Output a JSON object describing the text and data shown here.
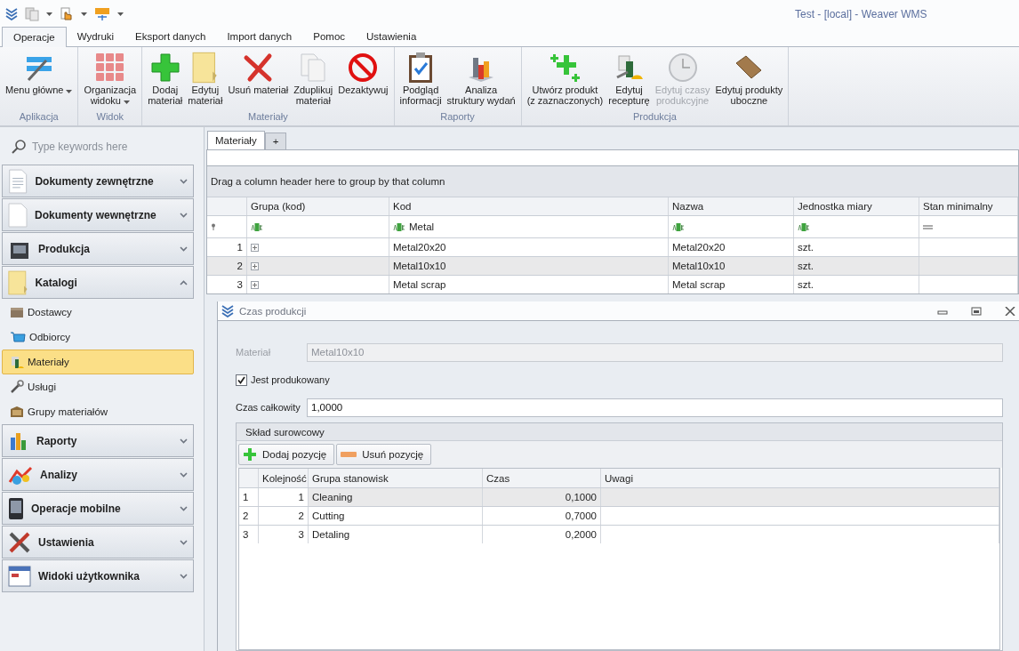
{
  "window": {
    "title": "Test - [local] - Weaver WMS"
  },
  "ribbon_tabs": [
    {
      "label": "Operacje",
      "selected": true
    },
    {
      "label": "Wydruki",
      "selected": false
    },
    {
      "label": "Eksport danych",
      "selected": false
    },
    {
      "label": "Import danych",
      "selected": false
    },
    {
      "label": "Pomoc",
      "selected": false
    },
    {
      "label": "Ustawienia",
      "selected": false
    }
  ],
  "ribbon_groups": [
    {
      "title": "Aplikacja",
      "buttons": [
        {
          "label": "Menu główne",
          "dropdown": true,
          "disabled": false
        }
      ]
    },
    {
      "title": "Widok",
      "buttons": [
        {
          "label": "Organizacja\nwidoku",
          "dropdown": true,
          "disabled": false
        }
      ]
    },
    {
      "title": "Materiały",
      "buttons": [
        {
          "label": "Dodaj\nmateriał",
          "dropdown": false,
          "disabled": false
        },
        {
          "label": "Edytuj\nmateriał",
          "dropdown": false,
          "disabled": false
        },
        {
          "label": "Usuń materiał",
          "dropdown": false,
          "disabled": false
        },
        {
          "label": "Zduplikuj\nmateriał",
          "dropdown": false,
          "disabled": false
        },
        {
          "label": "Dezaktywuj",
          "dropdown": false,
          "disabled": false
        }
      ]
    },
    {
      "title": "Raporty",
      "buttons": [
        {
          "label": "Podgląd\ninformacji",
          "dropdown": false,
          "disabled": false
        },
        {
          "label": "Analiza\nstruktury wydań",
          "dropdown": false,
          "disabled": false
        }
      ]
    },
    {
      "title": "Produkcja",
      "buttons": [
        {
          "label": "Utwórz produkt\n(z zaznaczonych)",
          "dropdown": false,
          "disabled": false
        },
        {
          "label": "Edytuj\nrecepturę",
          "dropdown": false,
          "disabled": false
        },
        {
          "label": "Edytuj czasy\nprodukcyjne",
          "dropdown": false,
          "disabled": true
        },
        {
          "label": "Edytuj produkty\nuboczne",
          "dropdown": false,
          "disabled": false
        }
      ]
    }
  ],
  "sidebar": {
    "search": {
      "placeholder": "Type keywords here"
    },
    "groups": [
      {
        "label": "Dokumenty zewnętrzne",
        "expanded": false
      },
      {
        "label": "Dokumenty wewnętrzne",
        "expanded": false
      },
      {
        "label": "Produkcja",
        "expanded": false
      },
      {
        "label": "Katalogi",
        "expanded": true,
        "items": [
          {
            "label": "Dostawcy",
            "selected": false
          },
          {
            "label": "Odbiorcy",
            "selected": false
          },
          {
            "label": "Materiały",
            "selected": true
          },
          {
            "label": "Usługi",
            "selected": false
          },
          {
            "label": "Grupy materiałów",
            "selected": false
          }
        ]
      },
      {
        "label": "Raporty",
        "expanded": false
      },
      {
        "label": "Analizy",
        "expanded": false
      },
      {
        "label": "Operacje mobilne",
        "expanded": false
      },
      {
        "label": "Ustawienia",
        "expanded": false
      },
      {
        "label": "Widoki użytkownika",
        "expanded": false
      }
    ]
  },
  "document_tabs": [
    {
      "label": "Materiały",
      "selected": true
    },
    {
      "label": "+",
      "selected": false
    }
  ],
  "grid": {
    "group_panel": "Drag a column header here to group by that column",
    "columns": [
      "Grupa (kod)",
      "Kod",
      "Nazwa",
      "Jednostka miary",
      "Stan minimalny"
    ],
    "filters": [
      {
        "kind": "text"
      },
      {
        "kind": "text",
        "value": "Metal"
      },
      {
        "kind": "text"
      },
      {
        "kind": "text"
      },
      {
        "kind": "equals"
      }
    ],
    "rows": [
      {
        "number": "1",
        "selected": false,
        "cells": [
          "",
          "Metal20x20",
          "Metal20x20",
          "szt."
        ]
      },
      {
        "number": "2",
        "selected": true,
        "cells": [
          "",
          "Metal10x10",
          "Metal10x10",
          "szt."
        ]
      },
      {
        "number": "3",
        "selected": false,
        "cells": [
          "",
          "Metal scrap",
          "Metal scrap",
          "szt."
        ]
      }
    ]
  },
  "panel": {
    "title": "Czas produkcji",
    "material": {
      "label": "Materiał",
      "value": "Metal10x10",
      "disabled": true
    },
    "produced": {
      "label": "Jest produkowany",
      "checked": true
    },
    "total_time": {
      "label": "Czas całkowity",
      "value": "1,0000"
    },
    "composition": {
      "title": "Skład surowcowy",
      "buttons": [
        "Dodaj pozycję",
        "Usuń pozycję"
      ],
      "columns": [
        "Kolejność",
        "Grupa stanowisk",
        "Czas",
        "Uwagi"
      ],
      "rows": [
        {
          "number": "1",
          "selected": true,
          "cells": [
            "1",
            "Cleaning",
            "0,1000"
          ]
        },
        {
          "number": "2",
          "selected": false,
          "cells": [
            "2",
            "Cutting",
            "0,7000"
          ]
        },
        {
          "number": "3",
          "selected": false,
          "cells": [
            "3",
            "Detaling",
            "0,2000"
          ]
        }
      ]
    }
  }
}
